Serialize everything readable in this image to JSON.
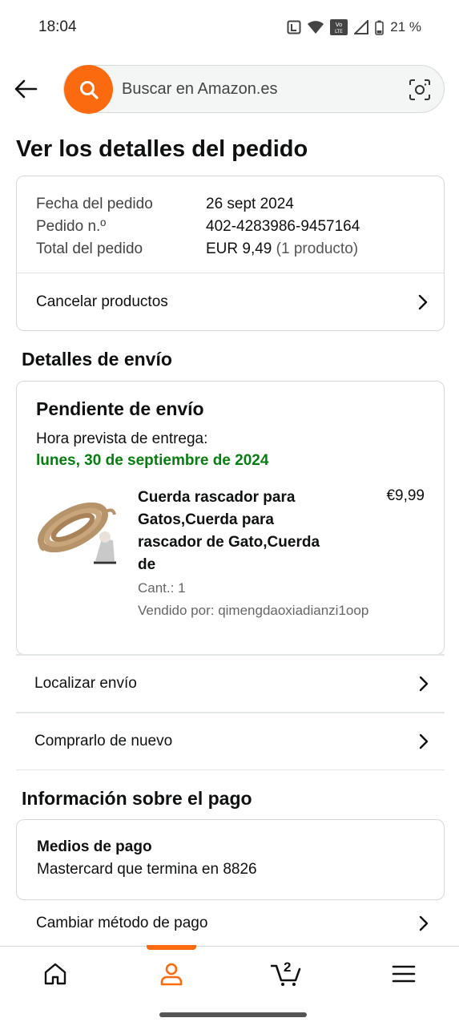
{
  "status_bar": {
    "time": "18:04",
    "battery": "21 %",
    "icons": [
      "nfc-icon",
      "wifi-icon",
      "volte-icon",
      "signal-icon",
      "battery-icon"
    ]
  },
  "search": {
    "placeholder": "Buscar en Amazon.es",
    "accent_color": "#fb6a0e"
  },
  "page": {
    "title": "Ver los detalles del pedido"
  },
  "order_summary": {
    "rows": [
      {
        "label": "Fecha del pedido",
        "value": "26 sept 2024"
      },
      {
        "label": "Pedido n.º",
        "value": "402-4283986-9457164"
      },
      {
        "label": "Total del pedido",
        "value": "EUR 9,49",
        "value_extra": "(1 producto)"
      }
    ],
    "cancel_label": "Cancelar productos"
  },
  "shipping": {
    "section_title": "Detalles de envío",
    "status": "Pendiente de envío",
    "eta_label": "Hora prevista de entrega:",
    "eta_date": "lunes, 30 de septiembre de 2024",
    "eta_color": "#067d0f",
    "product": {
      "name": "Cuerda rascador para Gatos,Cuerda para rascador de Gato,Cuerda de",
      "price": "€9,99",
      "quantity": "Cant.: 1",
      "seller": "Vendido por: qimengdaoxiadianzi1oop"
    },
    "track_label": "Localizar envío",
    "buy_again_label": "Comprarlo de nuevo"
  },
  "payment": {
    "section_title": "Información sobre el pago",
    "methods_heading": "Medios de pago",
    "method": "Mastercard  que termina en 8826",
    "change_label": "Cambiar método de pago"
  },
  "bottom_nav": {
    "items": [
      "home-icon",
      "account-icon",
      "cart-icon",
      "menu-icon"
    ],
    "active": "account-icon",
    "cart_count": "2"
  }
}
